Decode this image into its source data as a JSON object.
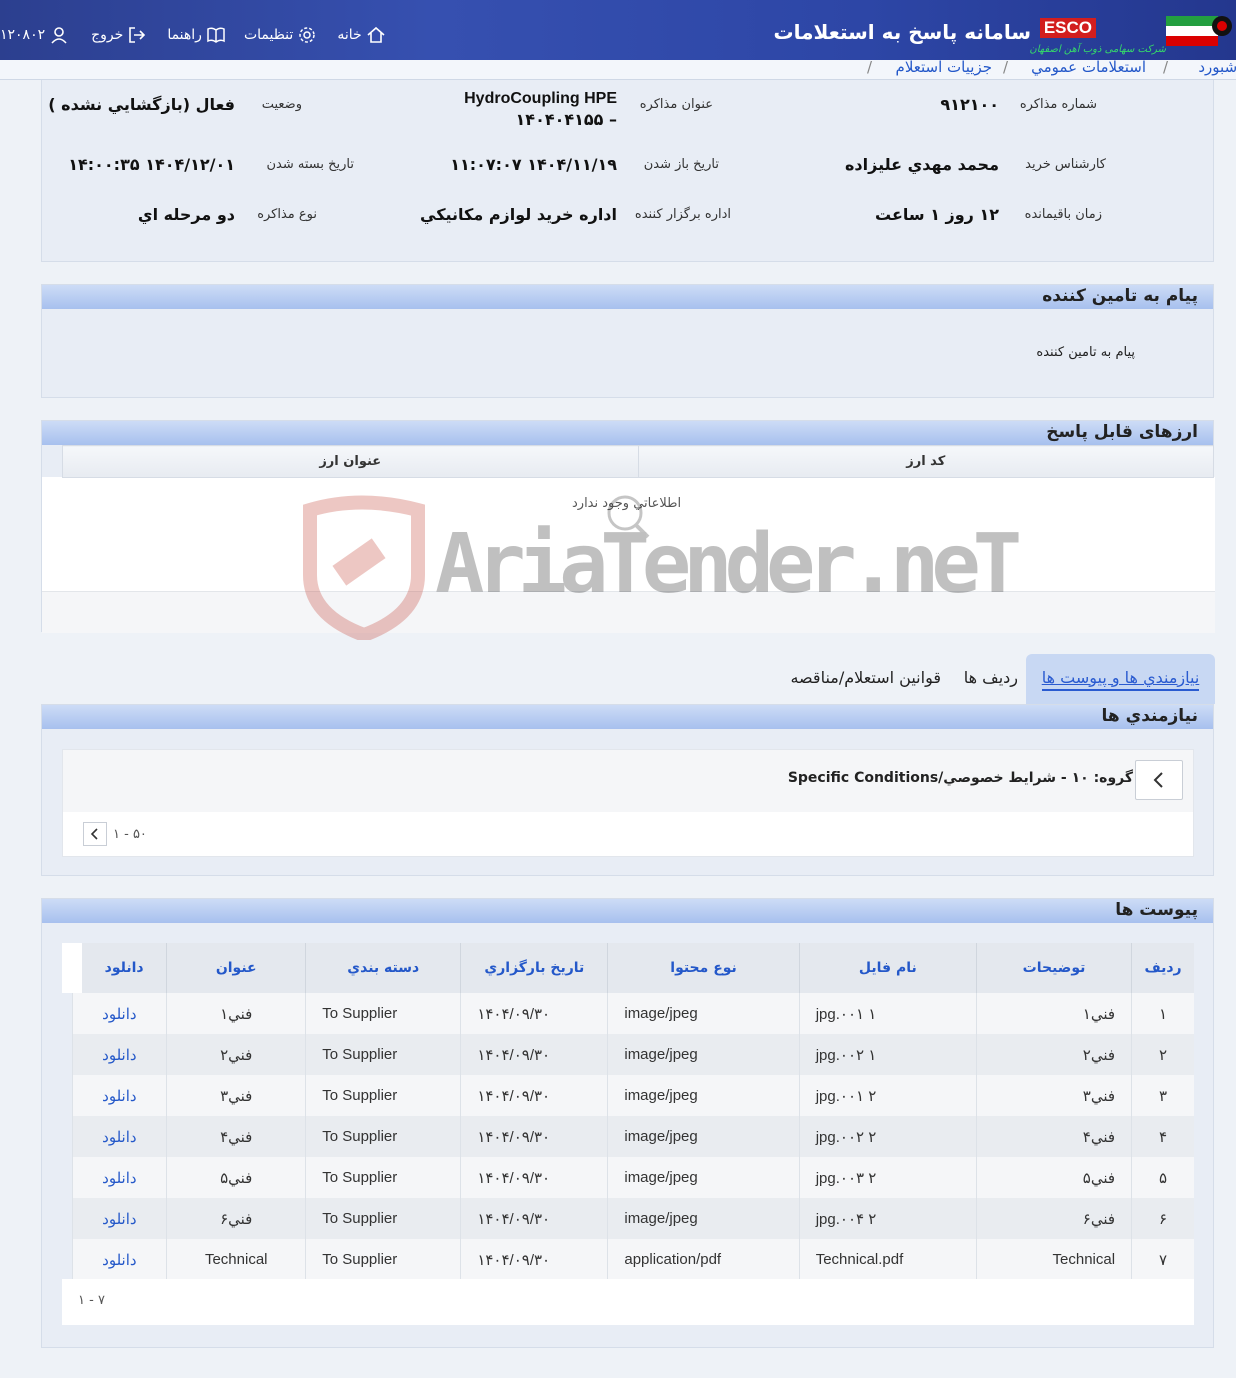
{
  "header": {
    "system_title": "سامانه پاسخ به استعلامات",
    "brand": "ESCO",
    "company": "شرکت سهامی ذوب آهن اصفهان",
    "nav": {
      "user_code": "۱۲۰۸۰۲",
      "logout": "خروج",
      "help": "راهنما",
      "settings": "تنظیمات",
      "home": "خانه"
    }
  },
  "breadcrumb": [
    "داشبورد",
    "استعلامات عمومي",
    "جزييات استعلام"
  ],
  "info": {
    "rows": [
      {
        "l1": "شماره مذاکره",
        "v1": "۹۱۲۱۰۰",
        "l2": "عنوان مذاکره",
        "v2a": "HydroCoupling HPE",
        "v2b": "– ۱۴۰۴۰۴۱۵۵",
        "l3": "وضعيت",
        "v3": "فعال (بازگشايي نشده )"
      },
      {
        "l1": "کارشناس خريد",
        "v1": "محمد مهدي عليزاده",
        "l2": "تاريخ باز شدن",
        "v2a": "۱۴۰۴/۱۱/۱۹ ۱۱:۰۷:۰۷",
        "l3": "تاريخ بسته شدن",
        "v3": "۱۴۰۴/۱۲/۰۱ ۱۴:۰۰:۳۵"
      },
      {
        "l1": "زمان باقيمانده",
        "v1": "۱۲ روز ۱ ساعت",
        "l2": "اداره برگزار کننده",
        "v2a": "اداره خريد لوازم مکانيکي",
        "l3": "نوع مذاکره",
        "v3": "دو مرحله اي"
      }
    ]
  },
  "message_panel": {
    "title": "پيام به تامين کننده",
    "body": "پيام به تامين کننده"
  },
  "currency_panel": {
    "title": "ارزهای قابل پاسخ",
    "columns": [
      "کد ارز",
      "عنوان ارز"
    ],
    "empty": "اطلاعاتي وجود ندارد"
  },
  "watermark": "AriaTender.neT",
  "tabs": [
    "نيازمندي ها و پيوست ها",
    "رديف ها",
    "قوانين استعلام/مناقصه"
  ],
  "requirements": {
    "title": "نيازمندي ها",
    "group": "گروه: ۱۰ - شرايط خصوصي/Specific Conditions",
    "pager": "۱ - ۵۰"
  },
  "attachments": {
    "title": "پيوست ها",
    "columns": [
      "رديف",
      "توضيحات",
      "نام فايل",
      "نوع محتوا",
      "تاريخ بارگزاري",
      "دسته بندي",
      "عنوان",
      "دانلود"
    ],
    "rows": [
      [
        "۱",
        "فني۱",
        "jpg.۰۰۱ ۱",
        "image/jpeg",
        "۱۴۰۴/۰۹/۳۰",
        "To Supplier",
        "فني۱",
        "دانلود"
      ],
      [
        "۲",
        "فني۲",
        "jpg.۰۰۲ ۱",
        "image/jpeg",
        "۱۴۰۴/۰۹/۳۰",
        "To Supplier",
        "فني۲",
        "دانلود"
      ],
      [
        "۳",
        "فني۳",
        "jpg.۰۰۱ ۲",
        "image/jpeg",
        "۱۴۰۴/۰۹/۳۰",
        "To Supplier",
        "فني۳",
        "دانلود"
      ],
      [
        "۴",
        "فني۴",
        "jpg.۰۰۲ ۲",
        "image/jpeg",
        "۱۴۰۴/۰۹/۳۰",
        "To Supplier",
        "فني۴",
        "دانلود"
      ],
      [
        "۵",
        "فني۵",
        "jpg.۰۰۳ ۲",
        "image/jpeg",
        "۱۴۰۴/۰۹/۳۰",
        "To Supplier",
        "فني۵",
        "دانلود"
      ],
      [
        "۶",
        "فني۶",
        "jpg.۰۰۴ ۲",
        "image/jpeg",
        "۱۴۰۴/۰۹/۳۰",
        "To Supplier",
        "فني۶",
        "دانلود"
      ],
      [
        "۷",
        "Technical",
        "Technical.pdf",
        "application/pdf",
        "۱۴۰۴/۰۹/۳۰",
        "To Supplier",
        "Technical",
        "دانلود"
      ]
    ],
    "pager": "۱ - ۷"
  }
}
